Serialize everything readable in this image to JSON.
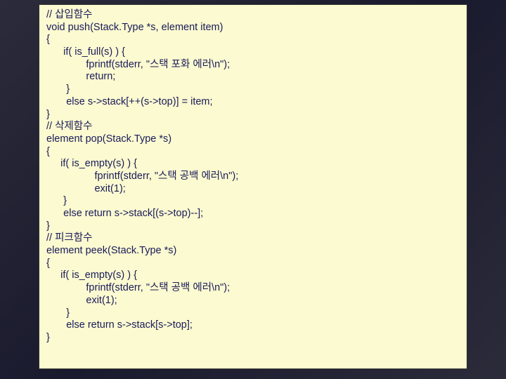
{
  "code": {
    "lines": [
      "// 삽입함수",
      "void push(Stack.Type *s, element item)",
      "{",
      "      if( is_full(s) ) {",
      "              fprintf(stderr, \"스택 포화 에러\\n\");",
      "              return;",
      "       }",
      "       else s->stack[++(s->top)] = item;",
      "}",
      "",
      "// 삭제함수",
      "element pop(Stack.Type *s)",
      "{",
      "     if( is_empty(s) ) {",
      "                 fprintf(stderr, \"스택 공백 에러\\n\");",
      "                 exit(1);",
      "      }",
      "      else return s->stack[(s->top)--];",
      "}",
      "",
      "// 피크함수",
      "element peek(Stack.Type *s)",
      "{",
      "     if( is_empty(s) ) {",
      "              fprintf(stderr, \"스택 공백 에러\\n\");",
      "              exit(1);",
      "       }",
      "       else return s->stack[s->top];",
      "}"
    ]
  }
}
